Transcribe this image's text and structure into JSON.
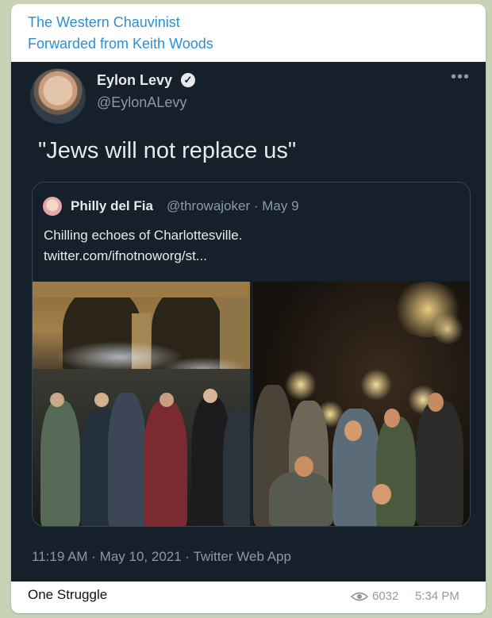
{
  "message": {
    "channel_name": "The Western Chauvinist",
    "forwarded_from": "Forwarded from Keith Woods",
    "caption": "One Struggle",
    "views": "6032",
    "time": "5:34 PM",
    "icons": {
      "views": "eye-icon"
    }
  },
  "tweet": {
    "author_name": "Eylon Levy",
    "author_handle": "@EylonALevy",
    "verified_icon": "verified-badge-icon",
    "more_label": "•••",
    "text": "\"Jews will not replace us\"",
    "meta": "11:19 AM · May 10, 2021 · Twitter Web App",
    "quoted": {
      "author_name": "Philly del Fia",
      "handle_date": "@throwajoker · May 9",
      "text_line1": "Chilling echoes of Charlottesville.",
      "text_line2": "twitter.com/ifnotnoworg/st..."
    }
  },
  "colors": {
    "tweet_bg": "#15202b",
    "link_blue": "#2b8fd6",
    "muted": "#8b98a5"
  }
}
